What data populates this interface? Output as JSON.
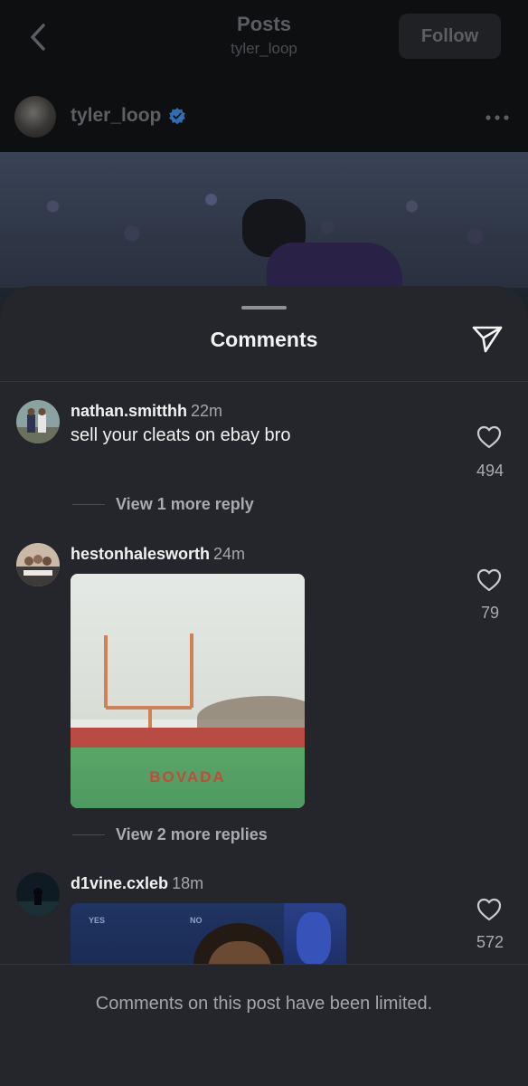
{
  "header": {
    "title": "Posts",
    "subtitle": "tyler_loop",
    "follow_label": "Follow"
  },
  "post": {
    "author": "tyler_loop",
    "verified": true
  },
  "comments_sheet": {
    "title": "Comments",
    "comments": [
      {
        "username": "nathan.smitthh",
        "time": "22m",
        "text": "sell your cleats on ebay bro",
        "likes": "494",
        "replies_label": "View 1 more reply"
      },
      {
        "username": "hestonhalesworth",
        "time": "24m",
        "media_text": "BOVADA",
        "likes": "79",
        "replies_label": "View 2 more replies"
      },
      {
        "username": "d1vine.cxleb",
        "time": "18m",
        "media_labels": [
          "YES",
          "NO"
        ],
        "likes": "572"
      }
    ],
    "footer_text": "Comments on this post have been limited."
  },
  "colors": {
    "sheet_bg": "#25262b",
    "page_bg": "#0e0f11",
    "verified_blue": "#2f6fb0"
  }
}
